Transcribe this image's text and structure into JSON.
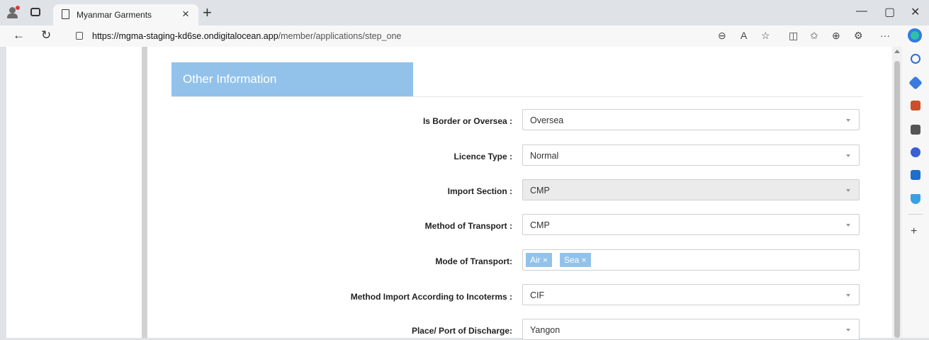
{
  "browser": {
    "tab_title": "Myanmar Garments",
    "tab_close": "×",
    "new_tab": "+",
    "url_domain": "https://mgma-staging-kd6se.ondigitalocean.app",
    "url_path": "/member/applications/step_one",
    "window_controls": {
      "minimize": "—",
      "restore": "▢",
      "close": "✕"
    },
    "nav": {
      "back": "←",
      "reload": "↻"
    },
    "toolbar_glyphs": {
      "zoom": "⊖",
      "read_aloud": "A",
      "favorite": "☆",
      "split": "◫",
      "favorites": "✩",
      "collections": "⊕",
      "extensions": "⚙",
      "more": "···"
    }
  },
  "form": {
    "section_title": "Other Information",
    "fields": [
      {
        "label": "Is Border or Oversea :",
        "value": "Oversea"
      },
      {
        "label": "Licence Type :",
        "value": "Normal"
      },
      {
        "label": "Import Section :",
        "value": "CMP"
      },
      {
        "label": "Method of Transport :",
        "value": "CMP"
      },
      {
        "label": "Mode of Transport:",
        "tags": [
          "Air ×",
          "Sea ×"
        ]
      },
      {
        "label": "Method Import According to Incoterms :",
        "value": "CIF"
      },
      {
        "label": "Place/ Port of Discharge:",
        "value": "Yangon"
      }
    ]
  },
  "sidebar": {
    "add": "+"
  },
  "colors": {
    "accent": "#92c2ea",
    "disabled_bg": "#ebebeb"
  }
}
